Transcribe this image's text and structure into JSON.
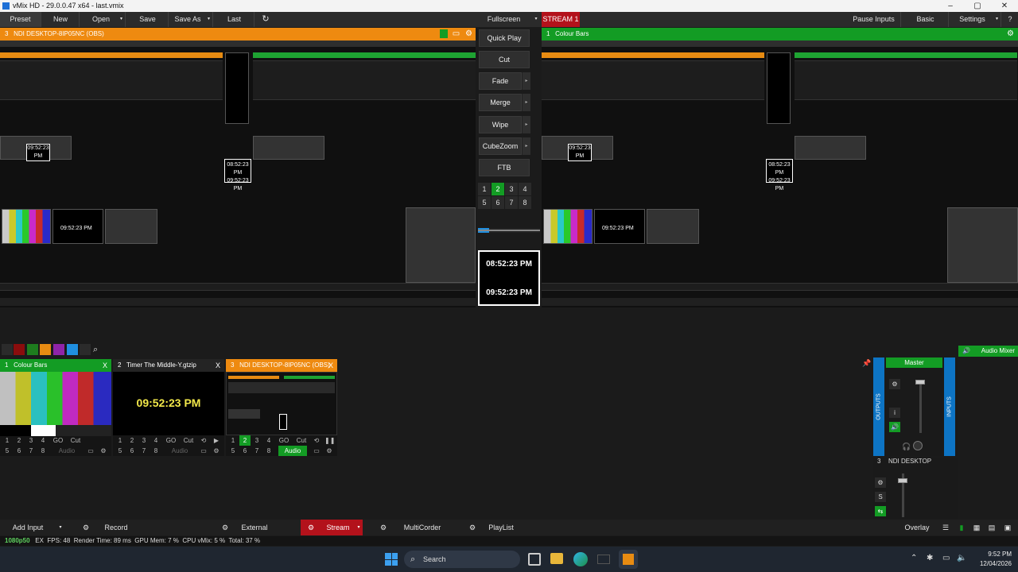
{
  "window": {
    "title": "vMix HD - 29.0.0.47 x64 - last.vmix",
    "min": "–",
    "max": "▢",
    "close": "✕"
  },
  "menu": {
    "preset": "Preset",
    "new": "New",
    "open": "Open",
    "save": "Save",
    "save_as": "Save As",
    "last": "Last",
    "fullscreen": "Fullscreen",
    "stream_label": "STREAM 1",
    "pause_inputs": "Pause Inputs",
    "basic": "Basic",
    "settings": "Settings",
    "help": "?"
  },
  "preview": {
    "number": "3",
    "title": "NDI DESKTOP-8IP05NC (OBS)"
  },
  "program": {
    "number": "1",
    "title": "Colour Bars"
  },
  "transitions": {
    "quick_play": "Quick Play",
    "cut": "Cut",
    "fade": "Fade",
    "merge": "Merge",
    "wipe": "Wipe",
    "cubezoom": "CubeZoom",
    "ftb": "FTB",
    "numbers": [
      "1",
      "2",
      "3",
      "4",
      "5",
      "6",
      "7",
      "8"
    ],
    "active_number": "2"
  },
  "clock": {
    "line1": "08:52:23 PM",
    "line2": "09:52:23 PM"
  },
  "monitor_text": {
    "clock_a": "08:52:23 PM",
    "clock_b": "09:52:23 PM",
    "timer": "09:52:23 PM"
  },
  "swatch_colors": [
    "#2b2b2b",
    "#8b0d0d",
    "#1e7d1e",
    "#e78b12",
    "#8f24a8",
    "#1f8fe0",
    "#2b2b2b"
  ],
  "inputs": [
    {
      "number": "1",
      "title": "Colour Bars",
      "close": "X",
      "state": "program",
      "row1": [
        "1",
        "2",
        "3",
        "4",
        "GO",
        "Cut"
      ],
      "row2": [
        "5",
        "6",
        "7",
        "8",
        "Audio"
      ]
    },
    {
      "number": "2",
      "title": "Timer The Middle-Y.gtzip",
      "close": "X",
      "state": "none",
      "display": "09:52:23 PM",
      "row1": [
        "1",
        "2",
        "3",
        "4",
        "GO",
        "Cut"
      ],
      "row2": [
        "5",
        "6",
        "7",
        "8",
        "Audio"
      ]
    },
    {
      "number": "3",
      "title": "NDI DESKTOP-8IP05NC (OBS)",
      "close": "X",
      "state": "preview",
      "row1": [
        "1",
        "2",
        "3",
        "4",
        "GO",
        "Cut"
      ],
      "row2": [
        "5",
        "6",
        "7",
        "8",
        "Audio"
      ]
    }
  ],
  "audio_mixer": {
    "title": "Audio Mixer",
    "master": "Master",
    "outputs": "OUTPUTS",
    "inputs": "INPUTS",
    "i": "i",
    "channel_number": "3",
    "channel_name": "NDI DESKTOP",
    "s": "S"
  },
  "bottom": {
    "add_input": "Add Input",
    "record": "Record",
    "external": "External",
    "stream": "Stream",
    "multicorder": "MultiCorder",
    "playlist": "PlayList",
    "overlay": "Overlay"
  },
  "status": {
    "resolution": "1080p50",
    "ex": "EX",
    "fps_label": "FPS:",
    "fps": "48",
    "render_label": "Render Time:",
    "render": "89 ms",
    "gpu_label": "GPU Mem:",
    "gpu": "7 %",
    "cpu_label": "CPU vMix:",
    "cpu": "5 %",
    "total_label": "Total:",
    "total": "37 %"
  },
  "taskbar": {
    "search": "Search",
    "time": "9:52 PM",
    "date": "12/04/2026"
  },
  "colors": {
    "preview": "#ee8a10",
    "program": "#139c24",
    "stream": "#b3121b",
    "accent": "#0d74c4"
  }
}
